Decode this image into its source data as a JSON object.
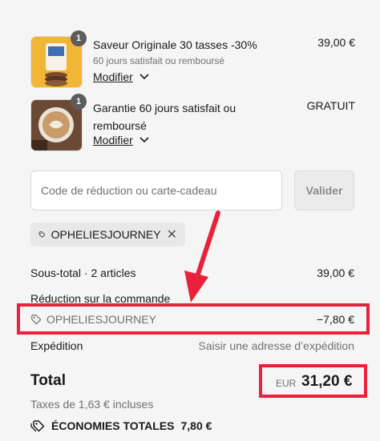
{
  "items": [
    {
      "title": "Saveur Originale 30 tasses -30%",
      "subtitle": "60 jours satisfait ou remboursé",
      "modify": "Modifier",
      "price": "39,00 €",
      "quantity": "1",
      "icon": "coffee-bag-thumbnail"
    },
    {
      "title_line1": "Garantie 60 jours satisfait ou",
      "title_line2": "remboursé",
      "modify": "Modifier",
      "price": "GRATUIT",
      "quantity": "1",
      "icon": "latte-cup-thumbnail"
    }
  ],
  "discount": {
    "placeholder": "Code de réduction ou carte-cadeau",
    "apply": "Valider",
    "applied_code": "OPHELIESJOURNEY"
  },
  "summary": {
    "subtotal_label": "Sous-total · 2 articles",
    "subtotal_value": "39,00 €",
    "order_discount_label": "Réduction sur la commande",
    "discount_code": "OPHELIESJOURNEY",
    "discount_value": "−7,80 €",
    "shipping_label": "Expédition",
    "shipping_value": "Saisir une adresse d’expédition",
    "total_label": "Total",
    "currency": "EUR",
    "total_value": "31,20 €",
    "taxes": "Taxes de 1,63 € incluses",
    "savings_label": "ÉCONOMIES TOTALES",
    "savings_value": "7,80 €"
  },
  "colors": {
    "annotation": "#e8223a",
    "background": "#f5f5f5"
  }
}
